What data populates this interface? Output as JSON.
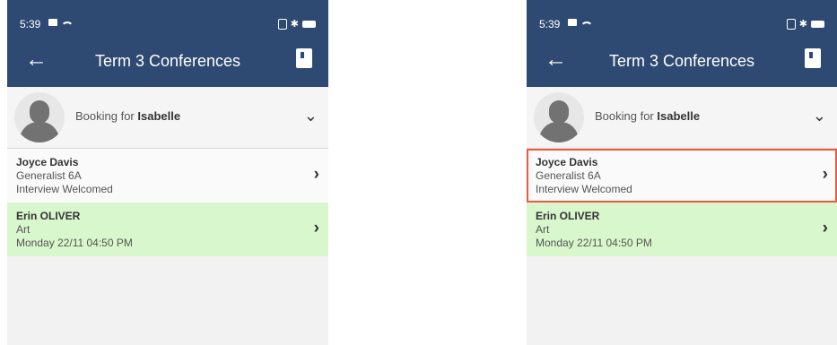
{
  "status_bar": {
    "time": "5:39"
  },
  "header": {
    "title": "Term 3 Conferences"
  },
  "booking": {
    "prefix": "Booking for",
    "student": "Isabelle"
  },
  "teachers": [
    {
      "name": "Joyce Davis",
      "subject": "Generalist 6A",
      "status": "Interview Welcomed"
    },
    {
      "name": "Erin OLIVER",
      "subject": "Art",
      "status": "Monday 22/11 04:50 PM"
    }
  ],
  "icons": {
    "back": "arrow-left",
    "book": "bookmark-book",
    "dropdown": "chevron-down",
    "row": "chevron-right"
  },
  "colors": {
    "header_bg": "#2f4a72",
    "booked_row_bg": "#d9f7cc",
    "highlight": "#ef5a3c"
  }
}
